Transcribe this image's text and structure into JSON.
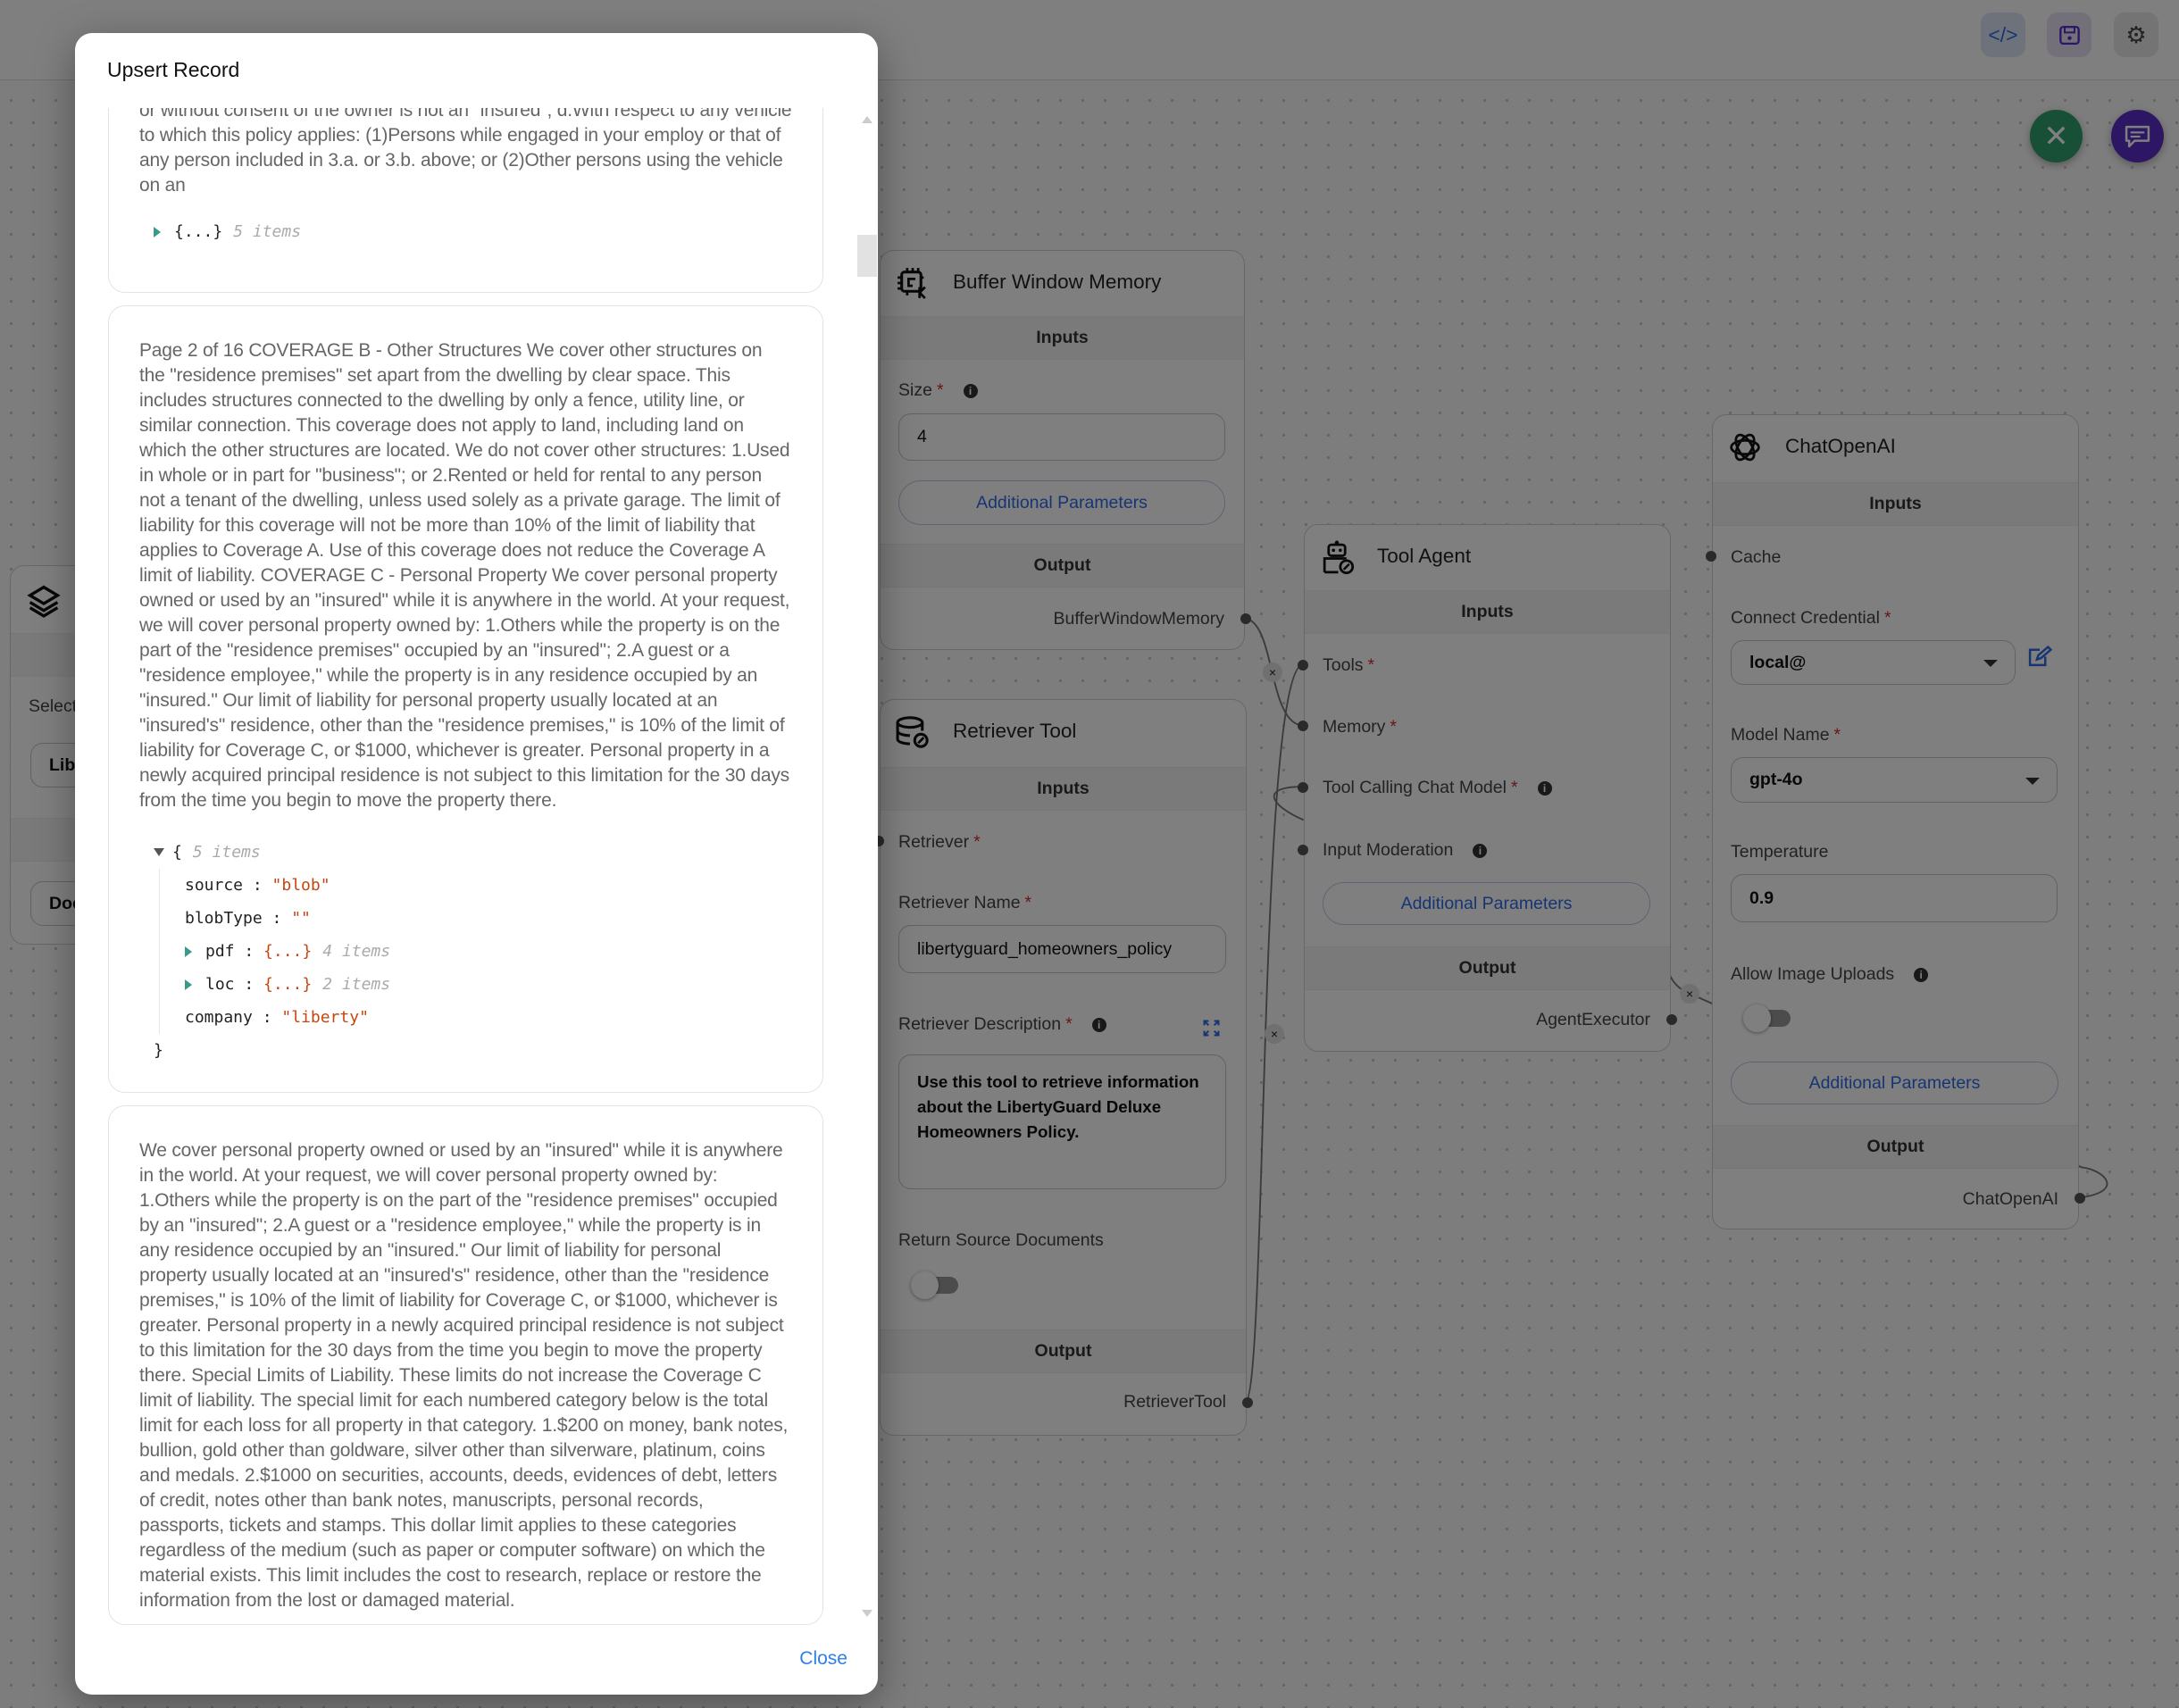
{
  "header": {
    "code_icon": "code-icon",
    "save_icon": "save-icon",
    "settings_icon": "gear-icon"
  },
  "fabs": {
    "close_color": "#2e9e6e",
    "chat_color": "#5b2fc9"
  },
  "left_node": {
    "select_label": "Select",
    "input1_value": "Libe",
    "input2_value": "Doc"
  },
  "buffer_memory": {
    "title": "Buffer Window Memory",
    "inputs_label": "Inputs",
    "size_label": "Size",
    "size_value": "4",
    "additional_params": "Additional Parameters",
    "output_label": "Output",
    "output_name": "BufferWindowMemory"
  },
  "retriever_tool": {
    "title": "Retriever Tool",
    "inputs_label": "Inputs",
    "retriever_label": "Retriever",
    "name_label": "Retriever Name",
    "name_value": "libertyguard_homeowners_policy",
    "description_label": "Retriever Description",
    "description_value": "Use this tool to retrieve information about the LibertyGuard Deluxe Homeowners Policy.",
    "return_source_label": "Return Source Documents",
    "return_source_on": false,
    "output_label": "Output",
    "output_name": "RetrieverTool"
  },
  "tool_agent": {
    "title": "Tool Agent",
    "inputs_label": "Inputs",
    "tools_label": "Tools",
    "memory_label": "Memory",
    "chat_model_label": "Tool Calling Chat Model",
    "moderation_label": "Input Moderation",
    "additional_params": "Additional Parameters",
    "output_label": "Output",
    "output_name": "AgentExecutor"
  },
  "chat_openai": {
    "title": "ChatOpenAI",
    "inputs_label": "Inputs",
    "cache_label": "Cache",
    "credential_label": "Connect Credential",
    "credential_value": "local@",
    "model_label": "Model Name",
    "model_value": "gpt-4o",
    "temperature_label": "Temperature",
    "temperature_value": "0.9",
    "image_uploads_label": "Allow Image Uploads",
    "image_uploads_on": false,
    "additional_params": "Additional Parameters",
    "output_label": "Output",
    "output_name": "ChatOpenAI"
  },
  "modal": {
    "title": "Upsert Record",
    "close_label": "Close",
    "records": [
      {
        "text": "or without consent of the owner is not an \"insured\"; d.With respect to any vehicle to which this policy applies: (1)Persons while engaged in your employ or that of any person included in 3.a. or 3.b. above; or (2)Other persons using the vehicle on an",
        "metadata_collapsed": "{...}",
        "metadata_count": "5 items"
      },
      {
        "text": "Page 2 of 16 COVERAGE B - Other Structures We cover other structures on the \"residence premises\" set apart from the dwelling by clear space. This includes structures connected to the dwelling by only a fence, utility line, or similar connection. This coverage does not apply to land, including land on which the other structures are located. We do not cover other structures: 1.Used in whole or in part for \"business\"; or 2.Rented or held for rental to any person not a tenant of the dwelling, unless used solely as a private garage. The limit of liability for this coverage will not be more than 10% of the limit of liability that applies to Coverage A. Use of this coverage does not reduce the Coverage A limit of liability. COVERAGE C - Personal Property We cover personal property owned or used by an \"insured\" while it is anywhere in the world. At your request, we will cover personal property owned by: 1.Others while the property is on the part of the \"residence premises\" occupied by an \"insured\"; 2.A guest or a \"residence employee,\" while the property is in any residence occupied by an \"insured.\" Our limit of liability for personal property usually located at an \"insured's\" residence, other than the \"residence premises,\" is 10% of the limit of liability for Coverage C, or $1000, whichever is greater. Personal property in a newly acquired principal residence is not subject to this limitation for the 30 days from the time you begin to move the property there.",
        "metadata": {
          "open_brace": "{",
          "close_brace": "}",
          "count": "5 items",
          "source_key": "source",
          "source_value": "\"blob\"",
          "blobType_key": "blobType",
          "blobType_value": "\"\"",
          "pdf_key": "pdf",
          "pdf_value": "{...}",
          "pdf_count": "4 items",
          "loc_key": "loc",
          "loc_value": "{...}",
          "loc_count": "2 items",
          "company_key": "company",
          "company_value": "\"liberty\""
        }
      },
      {
        "text": "We cover personal property owned or used by an \"insured\" while it is anywhere in the world. At your request, we will cover personal property owned by: 1.Others while the property is on the part of the \"residence premises\" occupied by an \"insured\"; 2.A guest or a \"residence employee,\" while the property is in any residence occupied by an \"insured.\" Our limit of liability for personal property usually located at an \"insured's\" residence, other than the \"residence premises,\" is 10% of the limit of liability for Coverage C, or $1000, whichever is greater. Personal property in a newly acquired principal residence is not subject to this limitation for the 30 days from the time you begin to move the property there. Special Limits of Liability. These limits do not increase the Coverage C limit of liability. The special limit for each numbered category below is the total limit for each loss for all property in that category. 1.$200 on money, bank notes, bullion, gold other than goldware, silver other than silverware, platinum, coins and medals. 2.$1000 on securities, accounts, deeds, evidences of debt, letters of credit, notes other than bank notes, manuscripts, personal records, passports, tickets and stamps. This dollar limit applies to these categories regardless of the medium (such as paper or computer software) on which the material exists. This limit includes the cost to research, replace or restore the information from the lost or damaged material."
      }
    ]
  }
}
